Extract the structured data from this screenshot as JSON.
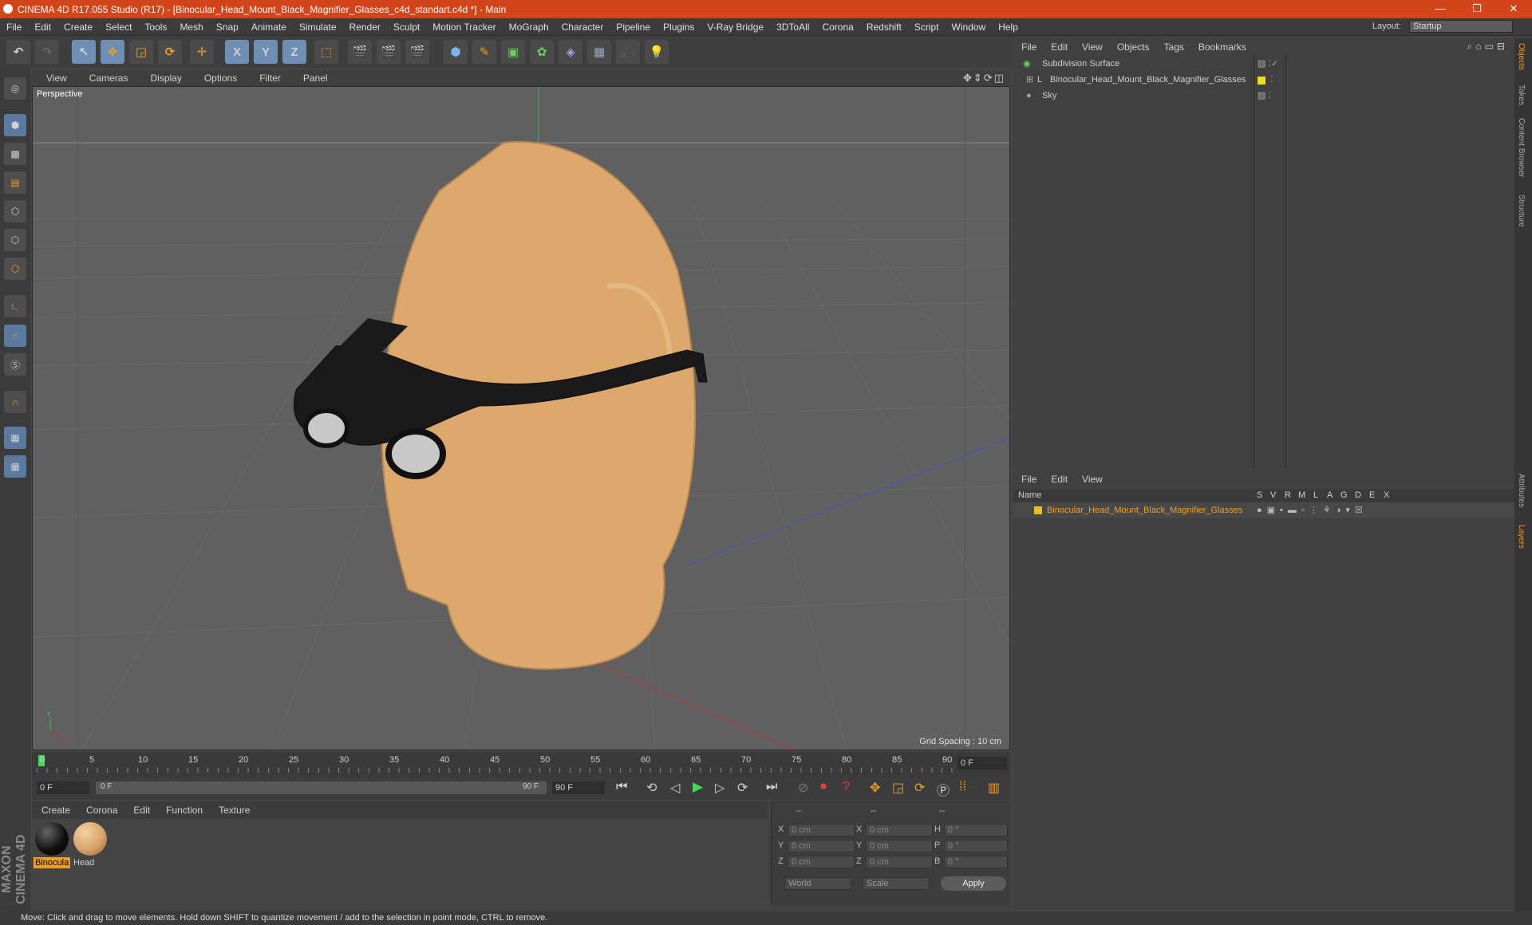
{
  "window": {
    "title": "CINEMA 4D R17.055 Studio (R17) - [Binocular_Head_Mount_Black_Magnifier_Glasses_c4d_standart.c4d *] - Main",
    "controls": [
      "—",
      "❐",
      "✕"
    ]
  },
  "menubar": {
    "items": [
      "File",
      "Edit",
      "Create",
      "Select",
      "Tools",
      "Mesh",
      "Snap",
      "Animate",
      "Simulate",
      "Render",
      "Sculpt",
      "Motion Tracker",
      "MoGraph",
      "Character",
      "Pipeline",
      "Plugins",
      "V-Ray Bridge",
      "3DToAll",
      "Corona",
      "Redshift",
      "Script",
      "Window",
      "Help"
    ],
    "layout_label": "Layout:",
    "layout_value": "Startup"
  },
  "toolbar": {
    "axis_labels": [
      "X",
      "Y",
      "Z"
    ]
  },
  "viewport": {
    "menu": [
      "View",
      "Cameras",
      "Display",
      "Options",
      "Filter",
      "Panel"
    ],
    "label": "Perspective",
    "grid_spacing": "Grid Spacing : 10 cm"
  },
  "timeline": {
    "ticks": [
      "0",
      "5",
      "10",
      "15",
      "20",
      "25",
      "30",
      "35",
      "40",
      "45",
      "50",
      "55",
      "60",
      "65",
      "70",
      "75",
      "80",
      "85",
      "90"
    ],
    "current_frame": "0 F",
    "start_field": "0 F",
    "range_start": "0 F",
    "range_end": "90 F",
    "end_field": "90 F"
  },
  "material_manager": {
    "menu": [
      "Create",
      "Corona",
      "Edit",
      "Function",
      "Texture"
    ],
    "materials": [
      {
        "name": "Binocula",
        "color": "#111111",
        "selected": true
      },
      {
        "name": "Head",
        "color": "#d8a46a",
        "selected": false
      }
    ]
  },
  "coordinates": {
    "headers": [
      "--",
      "--",
      "--"
    ],
    "rows": [
      {
        "a": "X",
        "av": "0 cm",
        "b": "X",
        "bv": "0 cm",
        "c": "H",
        "cv": "0 °"
      },
      {
        "a": "Y",
        "av": "0 cm",
        "b": "Y",
        "bv": "0 cm",
        "c": "P",
        "cv": "0 °"
      },
      {
        "a": "Z",
        "av": "0 cm",
        "b": "Z",
        "bv": "0 cm",
        "c": "B",
        "cv": "0 °"
      }
    ],
    "mode1": "World",
    "mode2": "Scale",
    "apply": "Apply"
  },
  "object_manager": {
    "menu": [
      "File",
      "Edit",
      "View",
      "Objects",
      "Tags",
      "Bookmarks"
    ],
    "objects": [
      {
        "name": "Subdivision Surface",
        "icon": "subdivision-icon"
      },
      {
        "name": "Binocular_Head_Mount_Black_Magnifier_Glasses",
        "icon": "null-object-icon"
      },
      {
        "name": "Sky",
        "icon": "sky-icon"
      }
    ]
  },
  "layer_manager": {
    "menu": [
      "File",
      "Edit",
      "View"
    ],
    "name_header": "Name",
    "columns": [
      "S",
      "V",
      "R",
      "M",
      "L",
      "A",
      "G",
      "D",
      "E",
      "X"
    ],
    "layers": [
      {
        "name": "Binocular_Head_Mount_Black_Magnifier_Glasses",
        "color": "#e8c020"
      }
    ]
  },
  "right_tabs": [
    "Objects",
    "Takes",
    "Content Browser",
    "Structure",
    "Attributes",
    "Layers"
  ],
  "status": "Move: Click and drag to move elements. Hold down SHIFT to quantize movement / add to the selection in point mode, CTRL to remove.",
  "branding": "MAXON CINEMA 4D",
  "colors": {
    "accent": "#d2451b",
    "highlight": "#f0a020",
    "panel": "#404040",
    "viewport": "#606060"
  }
}
